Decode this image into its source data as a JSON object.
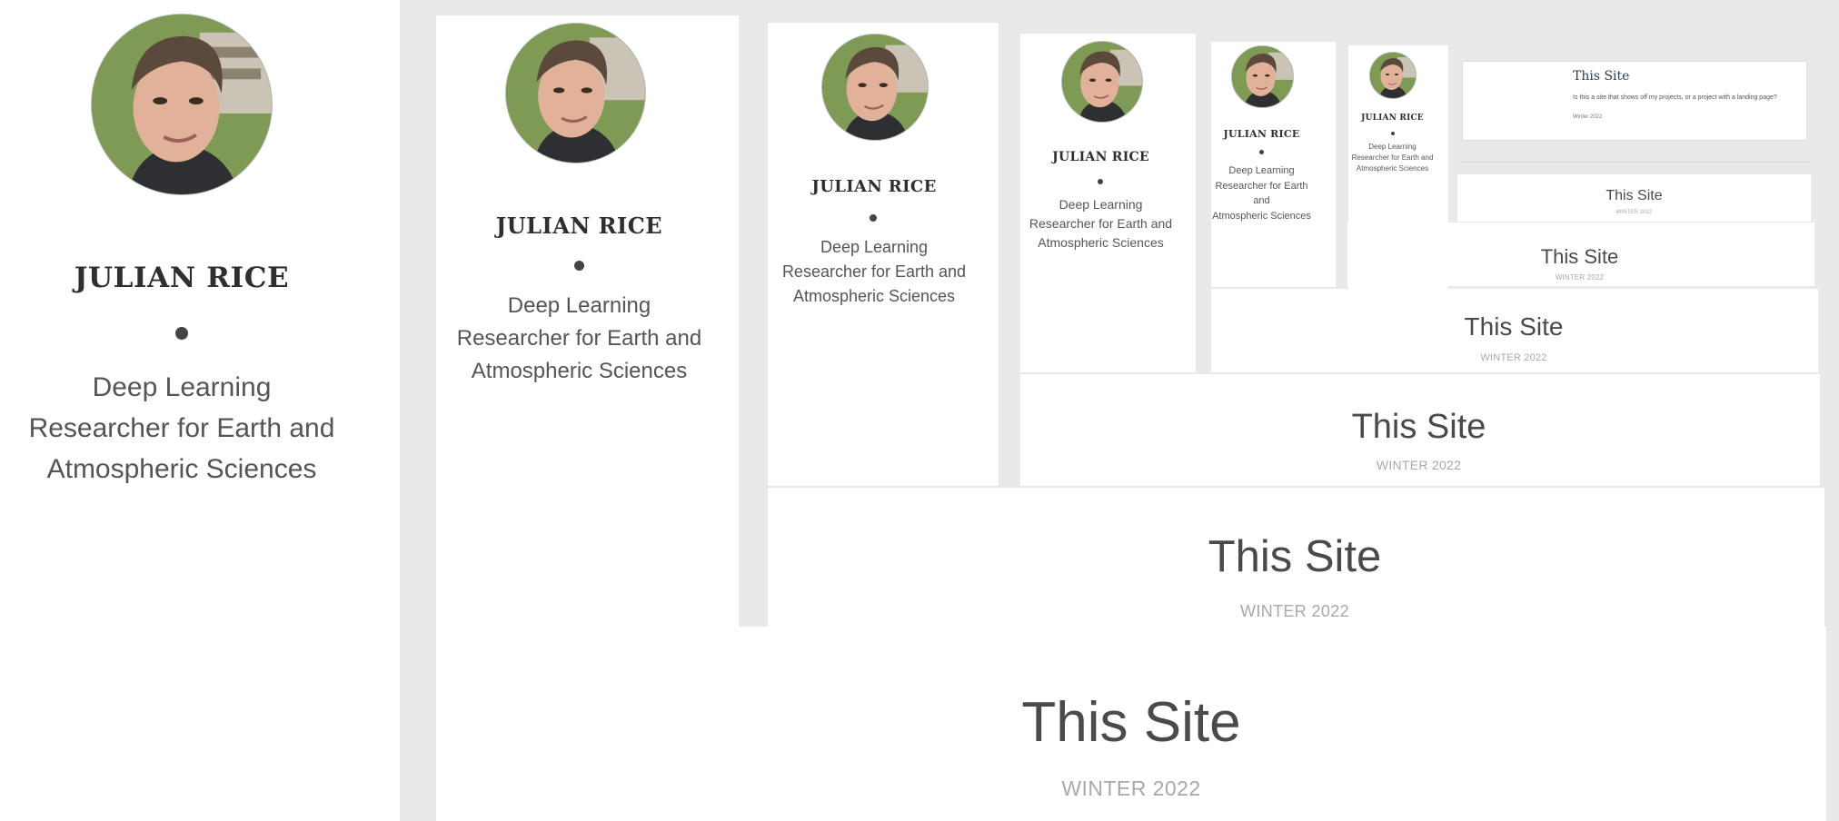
{
  "profile": {
    "name": "JULIAN RICE",
    "bullet": "●",
    "role_line1": "Deep Learning",
    "role_line2": "Researcher for Earth and",
    "role_line3": "Atmospheric Sciences"
  },
  "project": {
    "title": "This Site",
    "date": "WINTER 2022",
    "date_small": "Winter 2022",
    "description": "Is this a site that shows off my projects, or a project with a landing page?"
  },
  "colors": {
    "page_bg": "#e9e9e9",
    "card_bg": "#ffffff",
    "name_color": "#2f2f2f",
    "title_color": "#4a4a4a",
    "date_color": "#a8a8a8",
    "small_title_color": "#2d3e50"
  },
  "icons": {
    "avatar": "profile-photo-icon",
    "bullet": "dot-separator-icon"
  }
}
